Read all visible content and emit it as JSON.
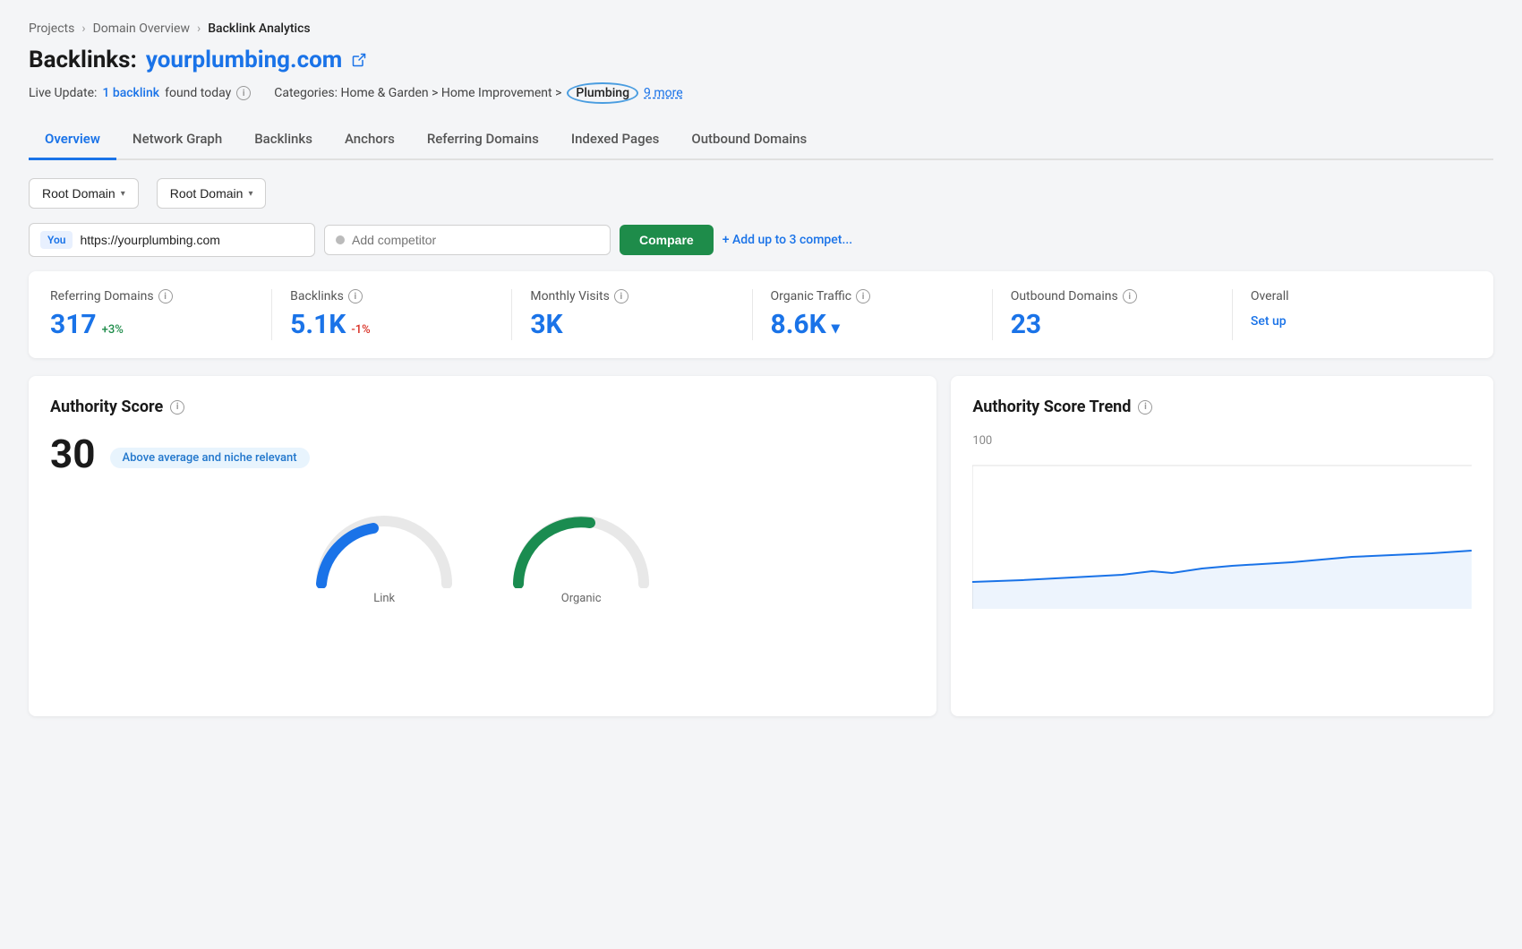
{
  "breadcrumb": {
    "items": [
      "Projects",
      "Domain Overview",
      "Backlink Analytics"
    ]
  },
  "page": {
    "title_prefix": "Backlinks:",
    "domain": "yourplumbing.com",
    "external_link_label": "↗"
  },
  "live_update": {
    "prefix": "Live Update:",
    "count": "1 backlink",
    "suffix": "found today",
    "info_icon": "i",
    "categories_prefix": "Categories: Home & Garden > Home Improvement >",
    "highlighted_category": "Plumbing",
    "more_label": "9 more"
  },
  "nav": {
    "tabs": [
      {
        "id": "overview",
        "label": "Overview",
        "active": true
      },
      {
        "id": "network-graph",
        "label": "Network Graph"
      },
      {
        "id": "backlinks",
        "label": "Backlinks"
      },
      {
        "id": "anchors",
        "label": "Anchors"
      },
      {
        "id": "referring-domains",
        "label": "Referring Domains"
      },
      {
        "id": "indexed-pages",
        "label": "Indexed Pages"
      },
      {
        "id": "outbound-domains",
        "label": "Outbound Domains"
      }
    ]
  },
  "filters": {
    "filter1_label": "Root Domain",
    "filter2_label": "Root Domain"
  },
  "url_inputs": {
    "you_badge": "You",
    "your_url": "https://yourplumbing.com",
    "competitor_placeholder": "Add competitor",
    "compare_label": "Compare",
    "add_competitor_label": "+ Add up to 3 compet..."
  },
  "metrics": [
    {
      "id": "referring-domains",
      "label": "Referring Domains",
      "value": "317",
      "change": "+3%",
      "change_type": "positive"
    },
    {
      "id": "backlinks",
      "label": "Backlinks",
      "value": "5.1K",
      "change": "-1%",
      "change_type": "negative"
    },
    {
      "id": "monthly-visits",
      "label": "Monthly Visits",
      "value": "3K",
      "change": "",
      "change_type": ""
    },
    {
      "id": "organic-traffic",
      "label": "Organic Traffic",
      "value": "8.6K",
      "change": "▾",
      "change_type": "neutral"
    },
    {
      "id": "outbound-domains",
      "label": "Outbound Domains",
      "value": "23",
      "change": "",
      "change_type": ""
    },
    {
      "id": "overall",
      "label": "Overall",
      "value": "Set up",
      "change": "",
      "change_type": "setup"
    }
  ],
  "authority_score_panel": {
    "title": "Authority Score",
    "score": "30",
    "badge": "Above average and niche relevant",
    "gauge_labels": [
      "Link",
      "Organic"
    ]
  },
  "trend_panel": {
    "title": "Authority Score Trend",
    "y_label": "100"
  }
}
